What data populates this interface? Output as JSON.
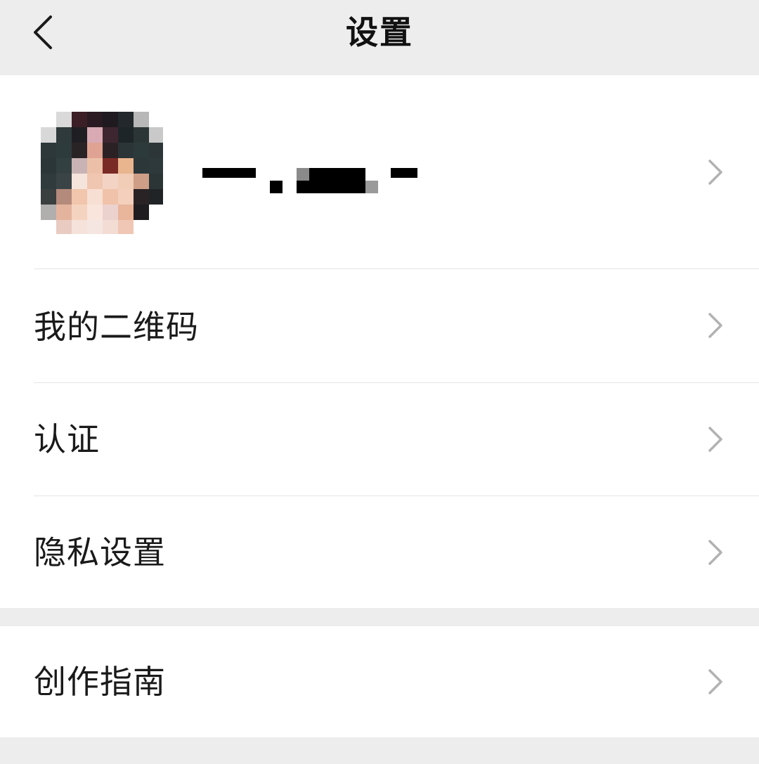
{
  "header": {
    "title": "设置",
    "back_icon": "chevron-left-icon"
  },
  "profile": {
    "avatar_icon": "blurred-avatar",
    "name_obscured": true
  },
  "menu_group_1": {
    "items": [
      {
        "label": "我的二维码",
        "icon": "chevron-right-icon"
      },
      {
        "label": "认证",
        "icon": "chevron-right-icon"
      },
      {
        "label": "隐私设置",
        "icon": "chevron-right-icon"
      }
    ]
  },
  "menu_group_2": {
    "items": [
      {
        "label": "创作指南",
        "icon": "chevron-right-icon"
      }
    ]
  },
  "colors": {
    "background": "#ededed",
    "card": "#ffffff",
    "text": "#1a1a1a",
    "chevron": "#b2b2b2",
    "divider": "#e5e5e5"
  }
}
